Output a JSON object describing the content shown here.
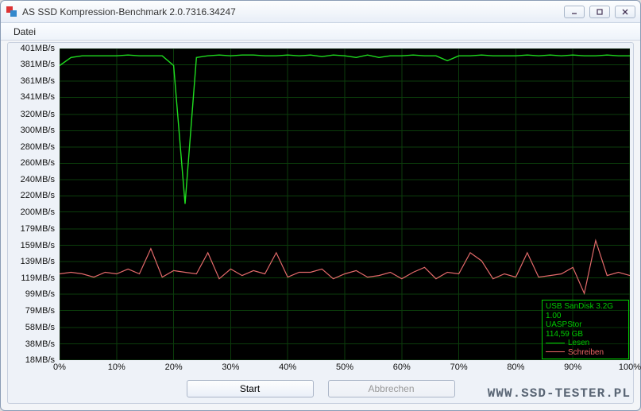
{
  "window": {
    "title": "AS SSD Kompression-Benchmark 2.0.7316.34247"
  },
  "menu": {
    "file": "Datei"
  },
  "buttons": {
    "start": "Start",
    "cancel": "Abbrechen"
  },
  "legend": {
    "device": "USB  SanDisk 3.2G",
    "version": "1.00",
    "driver": "UASPStor",
    "capacity": "114,59 GB",
    "read": "Lesen",
    "write": "Schreiben"
  },
  "watermark": "WWW.SSD-TESTER.PL",
  "chart_data": {
    "type": "line",
    "xlabel": "",
    "ylabel": "",
    "x_ticks": [
      "0%",
      "10%",
      "20%",
      "30%",
      "40%",
      "50%",
      "60%",
      "70%",
      "80%",
      "90%",
      "100%"
    ],
    "y_ticks": [
      "401MB/s",
      "381MB/s",
      "361MB/s",
      "341MB/s",
      "320MB/s",
      "300MB/s",
      "280MB/s",
      "260MB/s",
      "240MB/s",
      "220MB/s",
      "200MB/s",
      "179MB/s",
      "159MB/s",
      "139MB/s",
      "119MB/s",
      "99MB/s",
      "79MB/s",
      "58MB/s",
      "38MB/s",
      "18MB/s"
    ],
    "ylim": [
      18,
      401
    ],
    "xlim": [
      0,
      100
    ],
    "series": [
      {
        "name": "Lesen",
        "color": "#1fdd1f",
        "x": [
          0,
          2,
          4,
          6,
          8,
          10,
          12,
          14,
          16,
          18,
          20,
          22,
          24,
          26,
          28,
          30,
          32,
          34,
          36,
          38,
          40,
          42,
          44,
          46,
          48,
          50,
          52,
          54,
          56,
          58,
          60,
          62,
          64,
          66,
          68,
          70,
          72,
          74,
          76,
          78,
          80,
          82,
          84,
          86,
          88,
          90,
          92,
          94,
          96,
          98,
          100
        ],
        "values": [
          380,
          390,
          392,
          392,
          392,
          392,
          393,
          392,
          392,
          392,
          380,
          210,
          390,
          392,
          393,
          392,
          393,
          393,
          392,
          392,
          393,
          392,
          393,
          391,
          393,
          392,
          390,
          393,
          390,
          392,
          392,
          393,
          392,
          392,
          386,
          392,
          392,
          393,
          392,
          392,
          392,
          393,
          392,
          393,
          392,
          393,
          392,
          392,
          393,
          392,
          392
        ]
      },
      {
        "name": "Schreiben",
        "color": "#e36a6a",
        "x": [
          0,
          2,
          4,
          6,
          8,
          10,
          12,
          14,
          16,
          18,
          20,
          22,
          24,
          26,
          28,
          30,
          32,
          34,
          36,
          38,
          40,
          42,
          44,
          46,
          48,
          50,
          52,
          54,
          56,
          58,
          60,
          62,
          64,
          66,
          68,
          70,
          72,
          74,
          76,
          78,
          80,
          82,
          84,
          86,
          88,
          90,
          92,
          94,
          96,
          98,
          100
        ],
        "values": [
          124,
          126,
          124,
          120,
          126,
          124,
          130,
          124,
          155,
          120,
          128,
          126,
          124,
          150,
          118,
          130,
          122,
          128,
          124,
          150,
          120,
          126,
          126,
          130,
          118,
          124,
          128,
          120,
          122,
          126,
          118,
          126,
          132,
          118,
          126,
          124,
          150,
          140,
          118,
          124,
          120,
          150,
          120,
          122,
          124,
          132,
          100,
          165,
          122,
          126,
          122
        ]
      }
    ]
  }
}
